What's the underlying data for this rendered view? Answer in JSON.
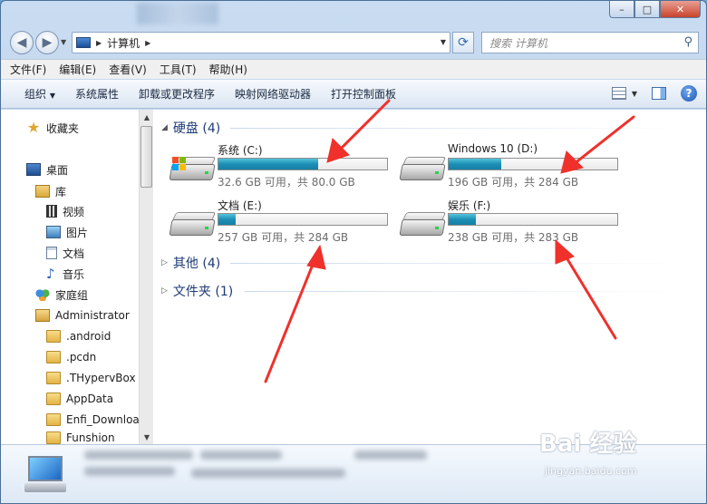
{
  "window": {
    "caption_buttons": [
      "–",
      "□",
      "✕"
    ]
  },
  "address": {
    "path": "计算机",
    "search_placeholder": "搜索 计算机"
  },
  "menubar": {
    "items": [
      "文件(F)",
      "编辑(E)",
      "查看(V)",
      "工具(T)",
      "帮助(H)"
    ]
  },
  "commandbar": {
    "items": [
      "组织",
      "系统属性",
      "卸载或更改程序",
      "映射网络驱动器",
      "打开控制面板"
    ],
    "organize_arrow": "▼"
  },
  "sidebar": {
    "favorites": "收藏夹",
    "desktop": "桌面",
    "library": "库",
    "video": "视频",
    "pictures": "图片",
    "documents": "文档",
    "music": "音乐",
    "homegroup": "家庭组",
    "user": "Administrator",
    "folders": [
      ".android",
      ".pcdn",
      ".THypervBox",
      "AppData",
      "Enfi_Download",
      "Funshion"
    ]
  },
  "groups": {
    "hard_disks": "硬盘 (4)",
    "other": "其他 (4)",
    "folders": "文件夹 (1)"
  },
  "drives": [
    {
      "name": "系统 (C:)",
      "free_text": "32.6 GB 可用，共 80.0 GB",
      "used_fraction": 0.59,
      "icon": "windows-drive-icon"
    },
    {
      "name": "Windows 10 (D:)",
      "free_text": "196 GB 可用，共 284 GB",
      "used_fraction": 0.31,
      "icon": "hard-drive-icon"
    },
    {
      "name": "文档 (E:)",
      "free_text": "257 GB 可用，共 284 GB",
      "used_fraction": 0.1,
      "icon": "hard-drive-icon"
    },
    {
      "name": "娱乐 (F:)",
      "free_text": "238 GB 可用，共 283 GB",
      "used_fraction": 0.16,
      "icon": "hard-drive-icon"
    }
  ],
  "watermark": {
    "logo": "Bai 经验",
    "url": "jingyan.baidu.com"
  },
  "colors": {
    "bar_fill": "#1d8fb4",
    "arrow": "#f0302b",
    "group_header": "#1e3b76"
  }
}
